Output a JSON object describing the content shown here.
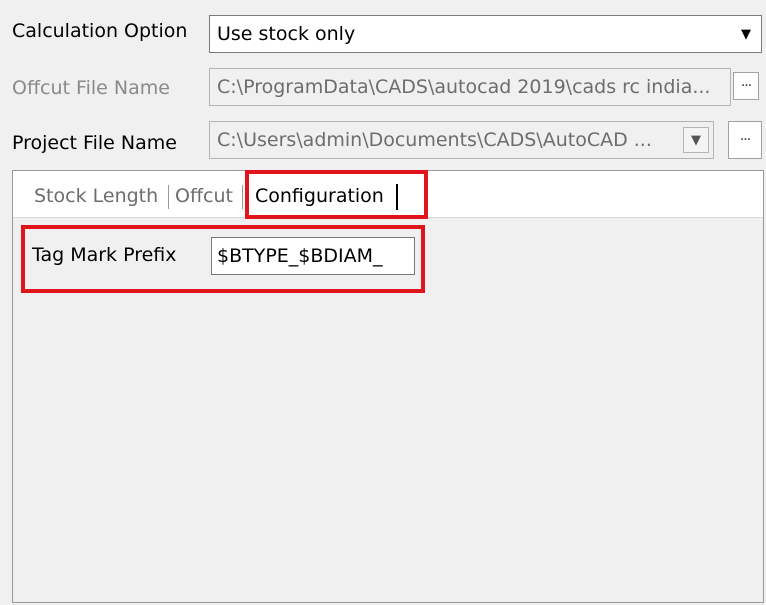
{
  "calculation_option": {
    "label": "Calculation Option",
    "value": "Use stock only",
    "dropdown_glyph": "▼"
  },
  "offcut_file": {
    "label": "Offcut File Name",
    "value": "C:\\ProgramData\\CADS\\autocad 2019\\cads rc india...",
    "browse_label": "···"
  },
  "project_file": {
    "label": "Project File Name",
    "value": "C:\\Users\\admin\\Documents\\CADS\\AutoCAD ...",
    "dropdown_glyph": "▼",
    "browse_label": "···"
  },
  "tabs": [
    {
      "label": "Stock Length",
      "active": false
    },
    {
      "label": "Offcut",
      "active": false
    },
    {
      "label": "Configuration",
      "active": true
    }
  ],
  "configuration": {
    "tag_mark_prefix_label": "Tag Mark Prefix",
    "tag_mark_prefix_value": "$BTYPE_$BDIAM_"
  },
  "colors": {
    "highlight": "#e1141c",
    "window_bg": "#f0f0f0",
    "disabled_text": "#8a8a8a"
  }
}
